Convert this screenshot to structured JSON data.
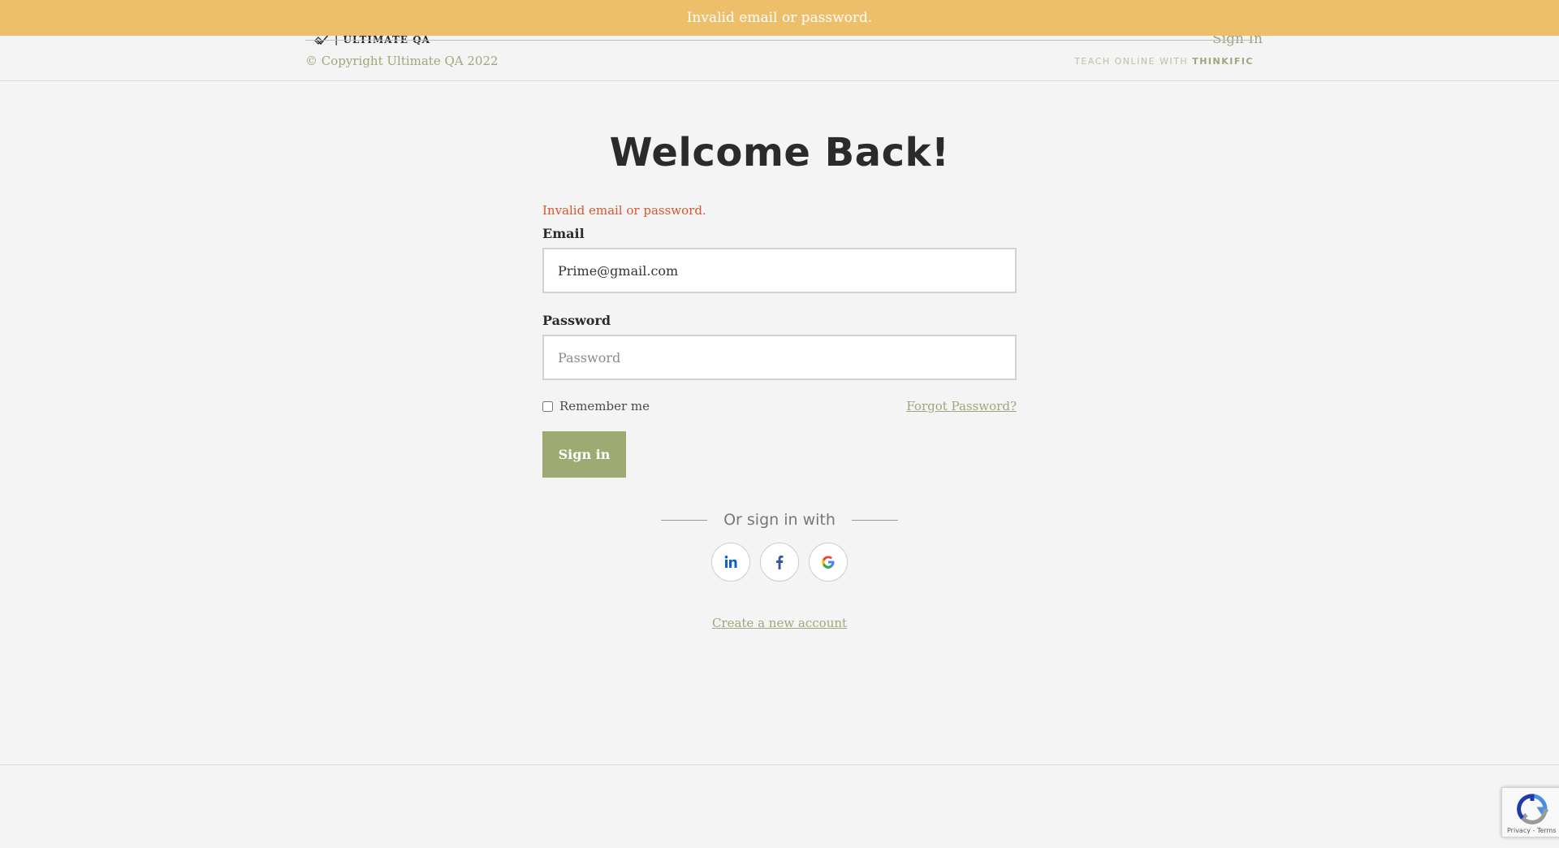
{
  "alert": {
    "message": "Invalid email or password."
  },
  "header": {
    "logo_text": "| ULTIMATE QA",
    "signin_link": "Sign In"
  },
  "main": {
    "title": "Welcome Back!",
    "error": "Invalid email or password.",
    "email": {
      "label": "Email",
      "value": "Prime@gmail.com"
    },
    "password": {
      "label": "Password",
      "placeholder": "Password",
      "value": ""
    },
    "remember_label": "Remember me",
    "forgot_link": "Forgot Password?",
    "signin_button": "Sign in",
    "divider_text": "Or sign in with",
    "social": [
      {
        "name": "linkedin",
        "icon": "linkedin-icon"
      },
      {
        "name": "facebook",
        "icon": "facebook-icon"
      },
      {
        "name": "google",
        "icon": "google-icon"
      }
    ],
    "create_account_link": "Create a new account"
  },
  "footer": {
    "copyright": "© Copyright Ultimate QA 2022",
    "powered_prefix": "TEACH ONLINE WITH",
    "powered_brand": "THINKIFIC"
  },
  "recaptcha": {
    "links": "Privacy - Terms"
  },
  "colors": {
    "alert_bg": "#edbf6b",
    "accent": "#9daa72",
    "error": "#d9552f",
    "link": "#9aa87a"
  }
}
